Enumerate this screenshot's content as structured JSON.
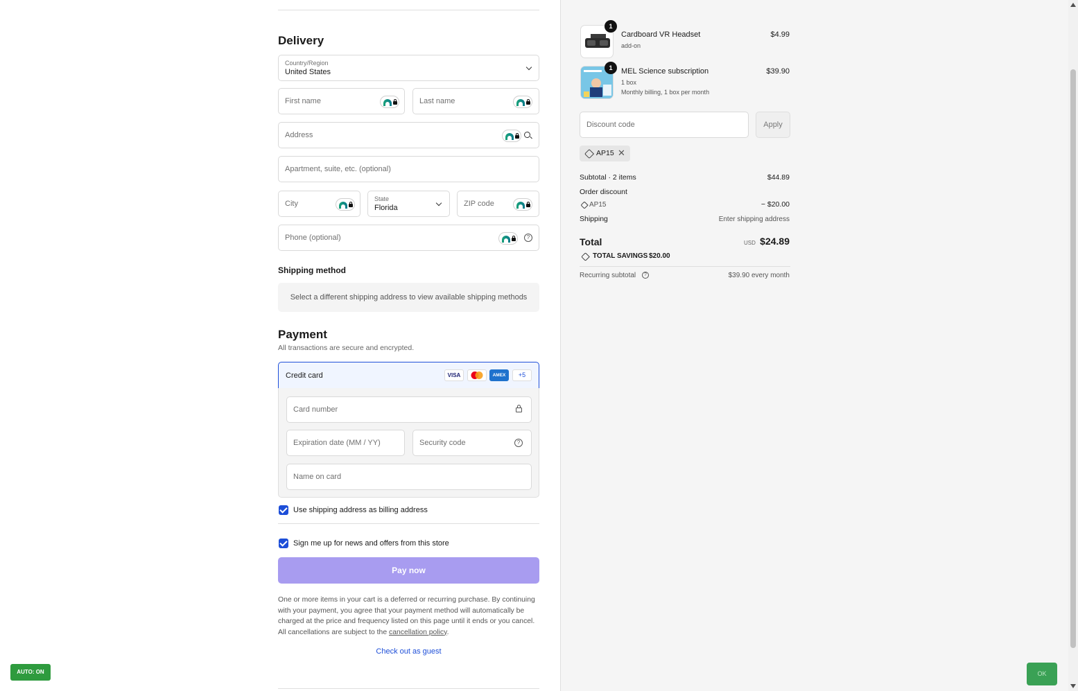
{
  "delivery": {
    "heading": "Delivery",
    "country_label": "Country/Region",
    "country_value": "United States",
    "first_name_placeholder": "First name",
    "last_name_placeholder": "Last name",
    "address_placeholder": "Address",
    "apartment_placeholder": "Apartment, suite, etc. (optional)",
    "city_placeholder": "City",
    "state_label": "State",
    "state_value": "Florida",
    "zip_placeholder": "ZIP code",
    "phone_placeholder": "Phone (optional)"
  },
  "shipping_method": {
    "heading": "Shipping method",
    "note": "Select a different shipping address to view available shipping methods"
  },
  "payment": {
    "heading": "Payment",
    "subheading": "All transactions are secure and encrypted.",
    "method_label": "Credit card",
    "card_brands": [
      "VISA",
      "Mastercard",
      "AMEX"
    ],
    "more_brands": "+5",
    "card_number_placeholder": "Card number",
    "expiration_placeholder": "Expiration date (MM / YY)",
    "security_placeholder": "Security code",
    "name_on_card_placeholder": "Name on card",
    "billing_checkbox_label": "Use shipping address as billing address",
    "billing_checked": true,
    "news_checkbox_label": "Sign me up for news and offers from this store",
    "news_checked": true,
    "pay_button": "Pay now",
    "legal_text": "One or more items in your cart is a deferred or recurring purchase. By continuing with your payment, you agree that your payment method will automatically be charged at the price and frequency listed on this page until it ends or you cancel. All cancellations are subject to the ",
    "legal_link": "cancellation policy",
    "legal_end": ".",
    "guest_link": "Check out as guest"
  },
  "summary": {
    "items": [
      {
        "name": "Cardboard VR Headset",
        "sub1": "add-on",
        "sub2": "",
        "price": "$4.99",
        "qty": "1"
      },
      {
        "name": "MEL Science subscription",
        "sub1": "1 box",
        "sub2": "Monthly billing, 1 box per month",
        "price": "$39.90",
        "qty": "1"
      }
    ],
    "discount_placeholder": "Discount code",
    "apply_button": "Apply",
    "applied_code": "AP15",
    "subtotal_label": "Subtotal · 2 items",
    "subtotal_value": "$44.89",
    "order_discount_label": "Order discount",
    "discount_code_row": "AP15",
    "discount_value": "− $20.00",
    "shipping_label": "Shipping",
    "shipping_value": "Enter shipping address",
    "total_label": "Total",
    "currency": "USD",
    "total_value": "$24.89",
    "savings_label": "TOTAL SAVINGS",
    "savings_value": "$20.00",
    "recurring_label": "Recurring subtotal",
    "recurring_value": "$39.90 every month"
  },
  "overlays": {
    "auto_badge": "AUTO: ON",
    "ok_button": "OK"
  },
  "colors": {
    "accent": "#1d4ed8",
    "pay_button": "#a89cf0",
    "auto_badge": "#2e9b3e"
  }
}
